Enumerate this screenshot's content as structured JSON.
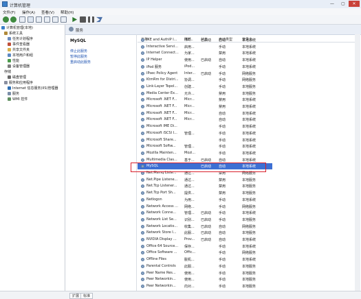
{
  "window": {
    "title": "计算机管理",
    "minimize": "—",
    "maximize": "▢",
    "close": "✕"
  },
  "menubar": [
    "文件(F)",
    "操作(A)",
    "查看(V)",
    "帮助(H)"
  ],
  "tree": [
    {
      "label": "计算机管理(本地)",
      "indent": 0
    },
    {
      "label": "系统工具",
      "indent": 1
    },
    {
      "label": "任务计划程序",
      "indent": 2
    },
    {
      "label": "事件查看器",
      "indent": 2
    },
    {
      "label": "共享文件夹",
      "indent": 2
    },
    {
      "label": "本地用户和组",
      "indent": 2
    },
    {
      "label": "性能",
      "indent": 2
    },
    {
      "label": "设备管理器",
      "indent": 2
    },
    {
      "label": "存储",
      "indent": 1
    },
    {
      "label": "磁盘管理",
      "indent": 2
    },
    {
      "label": "服务和应用程序",
      "indent": 1
    },
    {
      "label": "Internet 信息服务(IIS)管理器",
      "indent": 2
    },
    {
      "label": "服务",
      "indent": 2
    },
    {
      "label": "WMI 控件",
      "indent": 2
    }
  ],
  "panel": {
    "header": "服务"
  },
  "detail": {
    "title": "MySQL",
    "links": [
      "停止此服务",
      "暂停此服务",
      "重启动此服务"
    ]
  },
  "columns": [
    "名称",
    "描述",
    "状态",
    "启动类型",
    "登录为"
  ],
  "services": [
    [
      "IKE and AuthIP I...",
      "IKE...",
      "已启动",
      "自动",
      "本地系统"
    ],
    [
      "Interactive Servi...",
      "启用...",
      "",
      "手动",
      "本地系统"
    ],
    [
      "Internet Connect...",
      "为家...",
      "",
      "禁用",
      "本地系统"
    ],
    [
      "IP Helper",
      "使用...",
      "已启动",
      "自动",
      "本地系统"
    ],
    [
      "iPod 服务",
      "iPod...",
      "",
      "手动",
      "本地系统"
    ],
    [
      "IPsec Policy Agent",
      "Inter...",
      "已启动",
      "手动",
      "网络服务"
    ],
    [
      "KtmRm for Distri...",
      "协调...",
      "",
      "手动",
      "网络服务"
    ],
    [
      "Link-Layer Topol...",
      "创建...",
      "",
      "手动",
      "本地服务"
    ],
    [
      "Media Center Ex...",
      "允许...",
      "",
      "禁用",
      "本地服务"
    ],
    [
      "Microsoft .NET F...",
      "Micr...",
      "",
      "禁用",
      "本地系统"
    ],
    [
      "Microsoft .NET F...",
      "Micr...",
      "",
      "禁用",
      "本地系统"
    ],
    [
      "Microsoft .NET F...",
      "Micr...",
      "",
      "自动",
      "本地系统"
    ],
    [
      "Microsoft .NET F...",
      "Micr...",
      "",
      "自动",
      "本地系统"
    ],
    [
      "Microsoft IME Di...",
      "",
      "",
      "手动",
      "本地系统"
    ],
    [
      "Microsoft iSCSI I...",
      "管理...",
      "",
      "手动",
      "本地系统"
    ],
    [
      "Microsoft Share...",
      "",
      "",
      "手动",
      "本地系统"
    ],
    [
      "Microsoft Softw...",
      "管理...",
      "",
      "手动",
      "本地系统"
    ],
    [
      "Mozilla Mainten...",
      "Mozi...",
      "",
      "手动",
      "本地系统"
    ],
    [
      "Multimedia Clas...",
      "基于...",
      "已启动",
      "自动",
      "本地系统"
    ],
    [
      "MySQL",
      "",
      "已启动",
      "自动",
      "本地系统"
    ],
    [
      "Net.Msmq Liste...",
      "通过...",
      "",
      "禁用",
      "网络服务"
    ],
    [
      "Net.Pipe Listene...",
      "通过...",
      "",
      "禁用",
      "本地服务"
    ],
    [
      "Net.Tcp Listener...",
      "通过...",
      "",
      "禁用",
      "本地服务"
    ],
    [
      "Net.Tcp Port Sh...",
      "提供...",
      "",
      "禁用",
      "本地服务"
    ],
    [
      "Netlogon",
      "为用...",
      "",
      "手动",
      "本地系统"
    ],
    [
      "Network Access ...",
      "网络...",
      "",
      "手动",
      "网络服务"
    ],
    [
      "Network Conne...",
      "管理...",
      "已启动",
      "手动",
      "本地系统"
    ],
    [
      "Network List Se...",
      "识别...",
      "已启动",
      "手动",
      "本地服务"
    ],
    [
      "Network Locatio...",
      "收集...",
      "已启动",
      "自动",
      "网络服务"
    ],
    [
      "Network Store I...",
      "此服...",
      "已启动",
      "自动",
      "本地服务"
    ],
    [
      "NVIDIA Display ...",
      "Prov...",
      "已启动",
      "自动",
      "本地系统"
    ],
    [
      "Office 64 Source...",
      "保存...",
      "",
      "手动",
      "本地系统"
    ],
    [
      "Office Software ...",
      "Offic...",
      "",
      "手动",
      "网络服务"
    ],
    [
      "Offline Files",
      "脱机...",
      "",
      "手动",
      "本地系统"
    ],
    [
      "Parental Controls",
      "此服...",
      "",
      "手动",
      "本地服务"
    ],
    [
      "Peer Name Res...",
      "使用...",
      "",
      "手动",
      "本地服务"
    ],
    [
      "Peer Networkin...",
      "使用...",
      "",
      "手动",
      "本地服务"
    ],
    [
      "Peer Networkin...",
      "向对...",
      "",
      "手动",
      "本地服务"
    ],
    [
      "Performance Co...",
      "使远...",
      "",
      "手动",
      "本地服务"
    ]
  ],
  "selected_service": "MySQL",
  "bottom_tabs": [
    "扩展",
    "标准"
  ]
}
